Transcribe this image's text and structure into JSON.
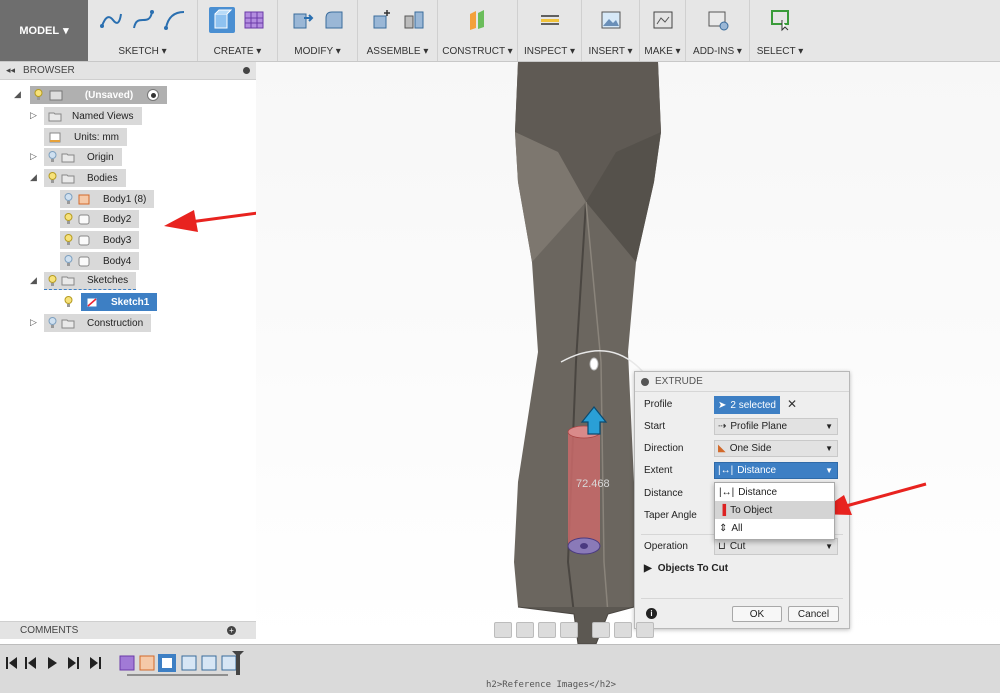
{
  "toolbar": {
    "model_label": "MODEL",
    "groups": [
      "SKETCH",
      "CREATE",
      "MODIFY",
      "ASSEMBLE",
      "CONSTRUCT",
      "INSPECT",
      "INSERT",
      "MAKE",
      "ADD-INS",
      "SELECT"
    ]
  },
  "browser": {
    "title": "BROWSER",
    "root": "(Unsaved)",
    "items": {
      "named_views": "Named Views",
      "units": "Units: mm",
      "origin": "Origin",
      "bodies": "Bodies",
      "body1": "Body1 (8)",
      "body2": "Body2",
      "body3": "Body3",
      "body4": "Body4",
      "sketches": "Sketches",
      "sketch1": "Sketch1",
      "construction": "Construction"
    }
  },
  "comments": {
    "title": "COMMENTS"
  },
  "viewport": {
    "dimension_value": "72.468"
  },
  "extrude": {
    "title": "EXTRUDE",
    "profile_label": "Profile",
    "profile_value": "2 selected",
    "start_label": "Start",
    "start_value": "Profile Plane",
    "direction_label": "Direction",
    "direction_value": "One Side",
    "extent_label": "Extent",
    "extent_value": "Distance",
    "distance_label": "Distance",
    "taper_label": "Taper Angle",
    "operation_label": "Operation",
    "operation_value": "Cut",
    "objects_to_cut": "Objects To Cut",
    "ok": "OK",
    "cancel": "Cancel",
    "extent_options": [
      "Distance",
      "To Object",
      "All"
    ]
  },
  "status_text": "h2>Reference Images</h2>",
  "colors": {
    "accent": "#3d7fc4",
    "arrow": "#e8231f",
    "body": "#6b665f",
    "cut": "#c96a6a"
  }
}
